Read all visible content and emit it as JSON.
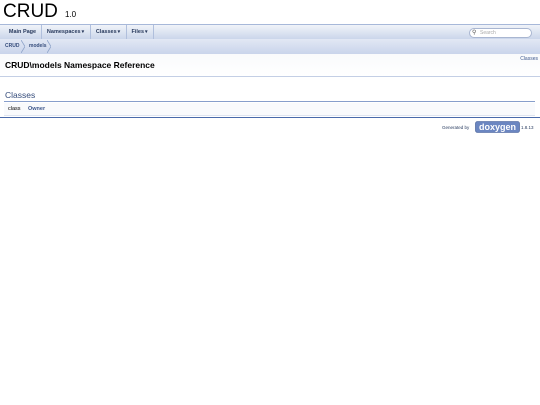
{
  "project": {
    "name": "CRUD",
    "number": "1.0"
  },
  "nav": {
    "items": [
      {
        "label": "Main Page",
        "dropdown": false
      },
      {
        "label": "Namespaces",
        "dropdown": true
      },
      {
        "label": "Classes",
        "dropdown": true
      },
      {
        "label": "Files",
        "dropdown": true
      }
    ],
    "dropdown_arrow": "▾",
    "search_placeholder": "Search"
  },
  "breadcrumb": [
    "CRUD",
    "models"
  ],
  "header": {
    "summary_link": "Classes",
    "title": "CRUD\\models Namespace Reference"
  },
  "classes_section": {
    "title": "Classes",
    "rows": [
      {
        "kind": "class",
        "name": "Owner"
      }
    ]
  },
  "footer": {
    "generated_by": "Generated by",
    "logo_text": "doxygen",
    "version": "1.8.13"
  },
  "colors": {
    "nav_text": "#283a5d",
    "link": "#3d578c",
    "section_title": "#354c7b",
    "footer_line": "#4a6aaa"
  }
}
